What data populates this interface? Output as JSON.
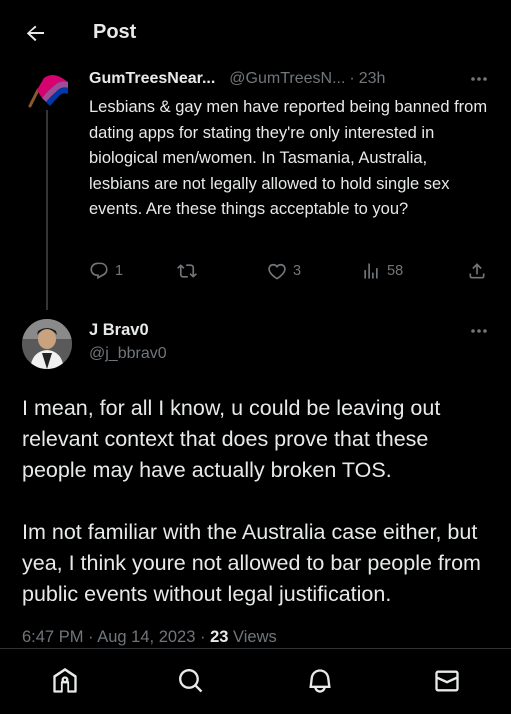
{
  "header": {
    "title": "Post",
    "back_icon": "arrow-left-icon"
  },
  "parent_post": {
    "display_name": "GumTreesNear...",
    "handle": "@GumTreesN...",
    "separator": "·",
    "time": "23h",
    "text": "Lesbians & gay men have reported being banned from dating apps for stating they're only interested in biological men/women. In Tasmania, Australia, lesbians are not legally allowed to hold single sex events. Are these things acceptable to you?",
    "actions": {
      "replies": "1",
      "reposts": "",
      "likes": "3",
      "views": "58"
    }
  },
  "reply_post": {
    "display_name": "J Brav0",
    "handle": "@j_bbrav0",
    "paragraph_1": "I mean, for all I know, u could be leaving out relevant context that does prove that these people may have actually broken TOS.",
    "paragraph_2": "Im not familiar with the Australia case either, but yea, I think youre not allowed to bar people from public events without legal justification.",
    "time": "6:47 PM",
    "date": "Aug 14, 2023",
    "separator": "·",
    "views_count": "23",
    "views_label": "Views"
  },
  "nav": {
    "items": [
      "home-icon",
      "search-icon",
      "notifications-icon",
      "messages-icon"
    ]
  },
  "colors": {
    "background": "#000000",
    "text": "#e7e9ea",
    "secondary": "#71767b",
    "divider": "#2f3336"
  }
}
